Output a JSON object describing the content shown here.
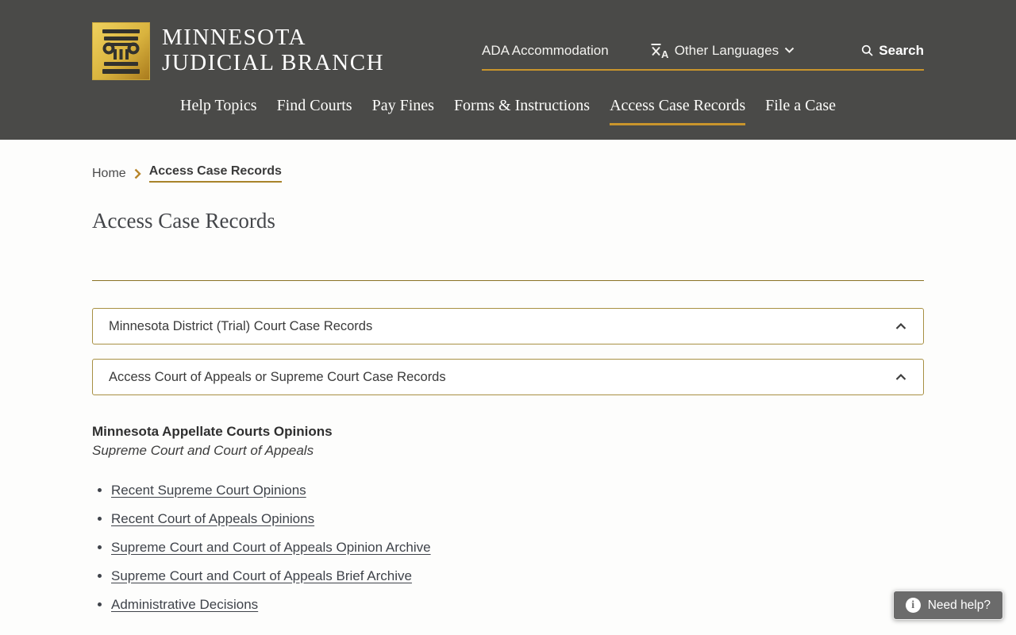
{
  "theme": {
    "header_bg": "#4a4a48",
    "gold_accent": "#c9952c",
    "gold_rule": "#8a7224",
    "accordion_border": "#a89043",
    "text_dark": "#3f434a",
    "help_bg": "#6b6b6b",
    "logo_gold_light": "#f0d25e",
    "logo_gold_dark": "#a8791c"
  },
  "header": {
    "logo": {
      "icon": "column-icon",
      "line1": "MINNESOTA",
      "line2": "JUDICIAL BRANCH"
    },
    "utility": {
      "ada_label": "ADA Accommodation",
      "languages_label": "Other Languages",
      "search_label": "Search",
      "icons": [
        "translate-icon",
        "chevron-down-icon",
        "search-icon"
      ]
    },
    "nav": {
      "items": [
        {
          "label": "Help Topics",
          "active": false
        },
        {
          "label": "Find Courts",
          "active": false
        },
        {
          "label": "Pay Fines",
          "active": false
        },
        {
          "label": "Forms & Instructions",
          "active": false
        },
        {
          "label": "Access Case Records",
          "active": true
        },
        {
          "label": "File a Case",
          "active": false
        }
      ]
    }
  },
  "breadcrumb": {
    "home": "Home",
    "separator_icon": "chevron-right-icon",
    "current": "Access Case Records"
  },
  "page": {
    "title": "Access Case Records"
  },
  "accordions": [
    {
      "label": "Minnesota District (Trial) Court Case Records",
      "state_icon": "chevron-up-icon"
    },
    {
      "label": "Access Court of Appeals or Supreme Court Case Records",
      "state_icon": "chevron-up-icon"
    }
  ],
  "opinions": {
    "heading": "Minnesota Appellate Courts Opinions",
    "subheading": "Supreme Court and Court of Appeals",
    "links": [
      "Recent Supreme Court Opinions",
      "Recent Court of Appeals Opinions",
      "Supreme Court and Court of Appeals Opinion Archive",
      "Supreme Court and Court of Appeals Brief Archive",
      "Administrative Decisions"
    ]
  },
  "help": {
    "label": "Need help?",
    "icon": "info-icon"
  }
}
